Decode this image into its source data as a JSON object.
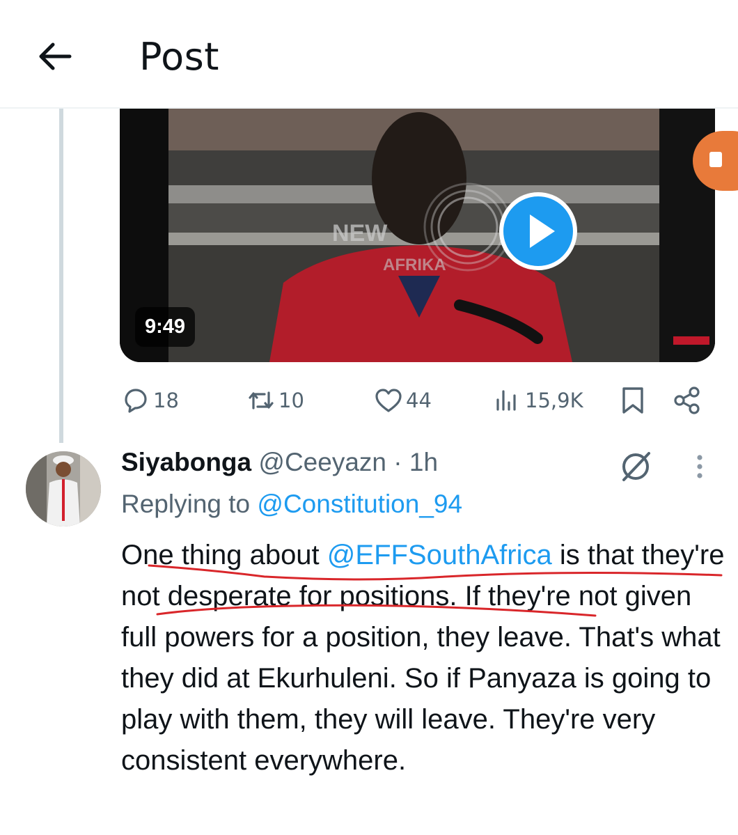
{
  "header": {
    "title": "Post"
  },
  "video": {
    "duration": "9:49"
  },
  "actions": {
    "replies": "18",
    "reposts": "10",
    "likes": "44",
    "views": "15,9K"
  },
  "reply": {
    "name": "Siyabonga",
    "handle": "@Ceeyazn",
    "separator": "·",
    "time": "1h",
    "replying_to_label": "Replying to",
    "replying_to_handle": "@Constitution_94",
    "text_before": "One thing about ",
    "mention": "@EFFSouthAfrica",
    "text_after": " is that they're not desperate for positions. If they're not given full powers for a position, they leave. That's what they did at Ekurhuleni. So if Panyaza is going to play with them, they will leave. They're very consistent everywhere."
  },
  "colors": {
    "accent": "#1d9bf0",
    "muted": "#536471",
    "annotation": "#d9262a"
  },
  "icons": [
    "back-arrow-icon",
    "play-icon",
    "reply-icon",
    "repost-icon",
    "like-icon",
    "views-icon",
    "bookmark-icon",
    "share-icon",
    "grok-icon",
    "more-icon"
  ]
}
